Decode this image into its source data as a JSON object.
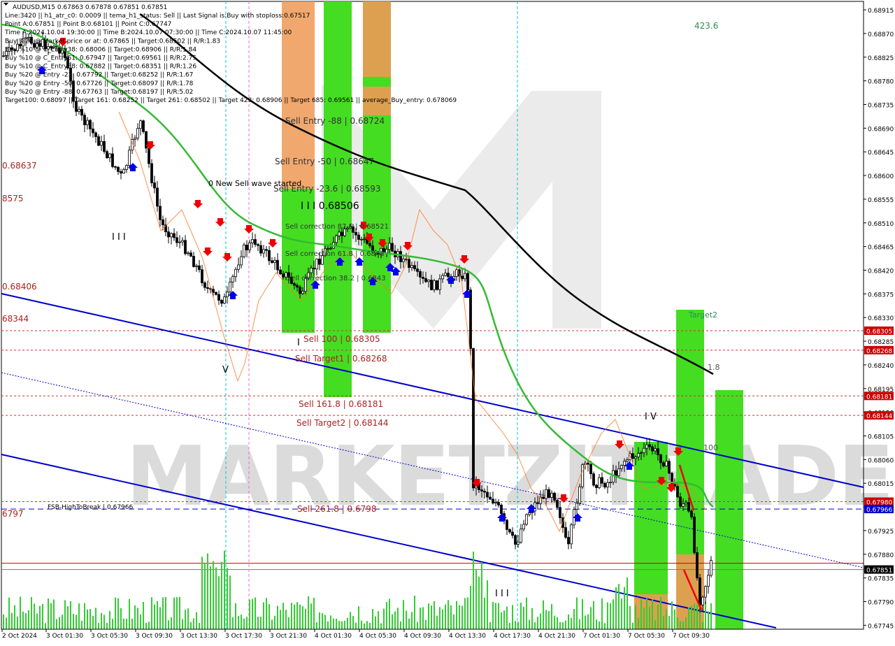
{
  "header": {
    "symbol_line": "AUDUSD,M15  0.67863 0.67878 0.67851 0.67851",
    "lines": [
      "Line:3420  ||  h1_atr_c0: 0.0009  ||  tema_h1_status: Sell  ||  Last Signal is:Buy with stoploss:0.67517",
      "Point A:0.67851  ||  Point B:0.68101  ||  Point C:0.67747",
      "Time A:2024.10.04 19:30:00  ||  Time B:2024.10.07 07:30:00  ||  Time C:2024.10.07 11:45:00",
      "Buy %20 @ Market price or at: 0.67865  ||  Target:0.68502  ||  R/R:1.83",
      "Buy %10 @ C_Entry38: 0.68006  ||  Target:0.68906  ||  R/R:1.84",
      "Buy %10 @ C_Entry61: 0.67947  ||  Target:0.69561  ||  R/R:2.75",
      "Buy %10 @ C_Entry88: 0.67882  ||  Target:0.68351  ||  R/R:1.26",
      "Buy %20 @ Entry -23: 0.67792  ||  Target:0.68252  ||  R/R:1.67",
      "Buy %20 @ Entry -50: 0.67726  ||  Target:0.68097  ||  R/R:1.78",
      "Buy %20 @ Entry -88: 0.67763  ||  Target:0.68197  ||  R/R:5.02",
      "Target100: 0.68097  ||  Target 161: 0.68252  ||  Target 261: 0.68502  ||  Target 423: 0.68906  ||  Target 685: 0.69561  ||  average_Buy_entry: 0.678069"
    ]
  },
  "chart_data": {
    "type": "candlestick",
    "symbol": "AUDUSD",
    "timeframe": "M15",
    "ylim": [
      0.67745,
      0.6893
    ],
    "y_ticks": [
      "0.68915",
      "0.68870",
      "0.68825",
      "0.68780",
      "0.68735",
      "0.68690",
      "0.68645",
      "0.68600",
      "0.68555",
      "0.68510",
      "0.68465",
      "0.68420",
      "0.68375",
      "0.68330",
      "0.68285",
      "0.68240",
      "0.68195",
      "0.68150",
      "0.68105",
      "0.68060",
      "0.68015",
      "0.67970",
      "0.67925",
      "0.67880",
      "0.67835",
      "0.67790",
      "0.67745"
    ],
    "x_ticks": [
      "2 Oct 2024",
      "3 Oct 01:30",
      "3 Oct 05:30",
      "3 Oct 09:30",
      "3 Oct 13:30",
      "3 Oct 17:30",
      "3 Oct 21:30",
      "4 Oct 01:30",
      "4 Oct 05:30",
      "4 Oct 09:30",
      "4 Oct 13:30",
      "4 Oct 17:30",
      "4 Oct 21:30",
      "7 Oct 01:30",
      "7 Oct 05:30",
      "7 Oct 09:30"
    ],
    "price_tags": [
      {
        "label": "0.68305",
        "color": "#cc0000"
      },
      {
        "label": "0.68268",
        "color": "#cc0000"
      },
      {
        "label": "0.68181",
        "color": "#cc0000"
      },
      {
        "label": "0.68144",
        "color": "#cc0000"
      },
      {
        "label": "0.67980",
        "color": "#cc0000"
      },
      {
        "label": "0.67966",
        "color": "#0000cc"
      },
      {
        "label": "0.67851",
        "color": "#000000"
      }
    ],
    "level_labels": [
      {
        "text": "Sell Entry -88 | 0.68724",
        "color": "#333333"
      },
      {
        "text": "Sell Entry -50 | 0.68647",
        "color": "#333333"
      },
      {
        "text": "Sell Entry -23.6 | 0.68593",
        "color": "#333333"
      },
      {
        "text": "I I I 0.68506",
        "color": "#000000"
      },
      {
        "text": "Sell correction 87.5 | 0.68521",
        "color": "#333333"
      },
      {
        "text": "Sell correction 61.8 | 0.6848",
        "color": "#333333"
      },
      {
        "text": "Sell correction 38.2 | 0.6843",
        "color": "#333333"
      },
      {
        "text": "Sell 100 | 0.68305",
        "color": "#aa2222"
      },
      {
        "text": "Sell Target1 | 0.68268",
        "color": "#aa2222"
      },
      {
        "text": "Sell 161.8 | 0.68181",
        "color": "#aa2222"
      },
      {
        "text": "Sell Target2 | 0.68144",
        "color": "#aa2222"
      },
      {
        "text": "Sell 261.8 | 0.6798",
        "color": "#aa2222"
      },
      {
        "text": "FSB-HighToBreak | 0.67966",
        "color": "#000000"
      },
      {
        "text": "0 New Sell wave started",
        "color": "#000000"
      },
      {
        "text": "423.6",
        "color": "#2e8b57"
      },
      {
        "text": "Target2",
        "color": "#2e8b57"
      },
      {
        "text": "1.8",
        "color": "#555555"
      },
      {
        "text": "100",
        "color": "#555555"
      },
      {
        "text": "I V",
        "color": "#000000"
      },
      {
        "text": "I I I",
        "color": "#000000"
      },
      {
        "text": "V",
        "color": "#000000"
      },
      {
        "text": "I",
        "color": "#000000"
      },
      {
        "text": "I I I",
        "color": "#000000"
      }
    ],
    "left_cut_labels": [
      {
        "text": "0.68637",
        "color": "#aa2222"
      },
      {
        "text": "8575",
        "color": "#aa2222"
      },
      {
        "text": "0.68406",
        "color": "#aa2222"
      },
      {
        "text": "68344",
        "color": "#aa2222"
      },
      {
        "text": "6797",
        "color": "#aa2222"
      }
    ],
    "watermark": "MARKETZITRADE",
    "colors": {
      "green_bar": "#44dd22",
      "orange_bar": "#ee9955",
      "ma_fast": "#33bb33",
      "ma_slow": "#000000",
      "channel": "#0000cc",
      "bull": "#000000",
      "bear": "#000000"
    }
  }
}
